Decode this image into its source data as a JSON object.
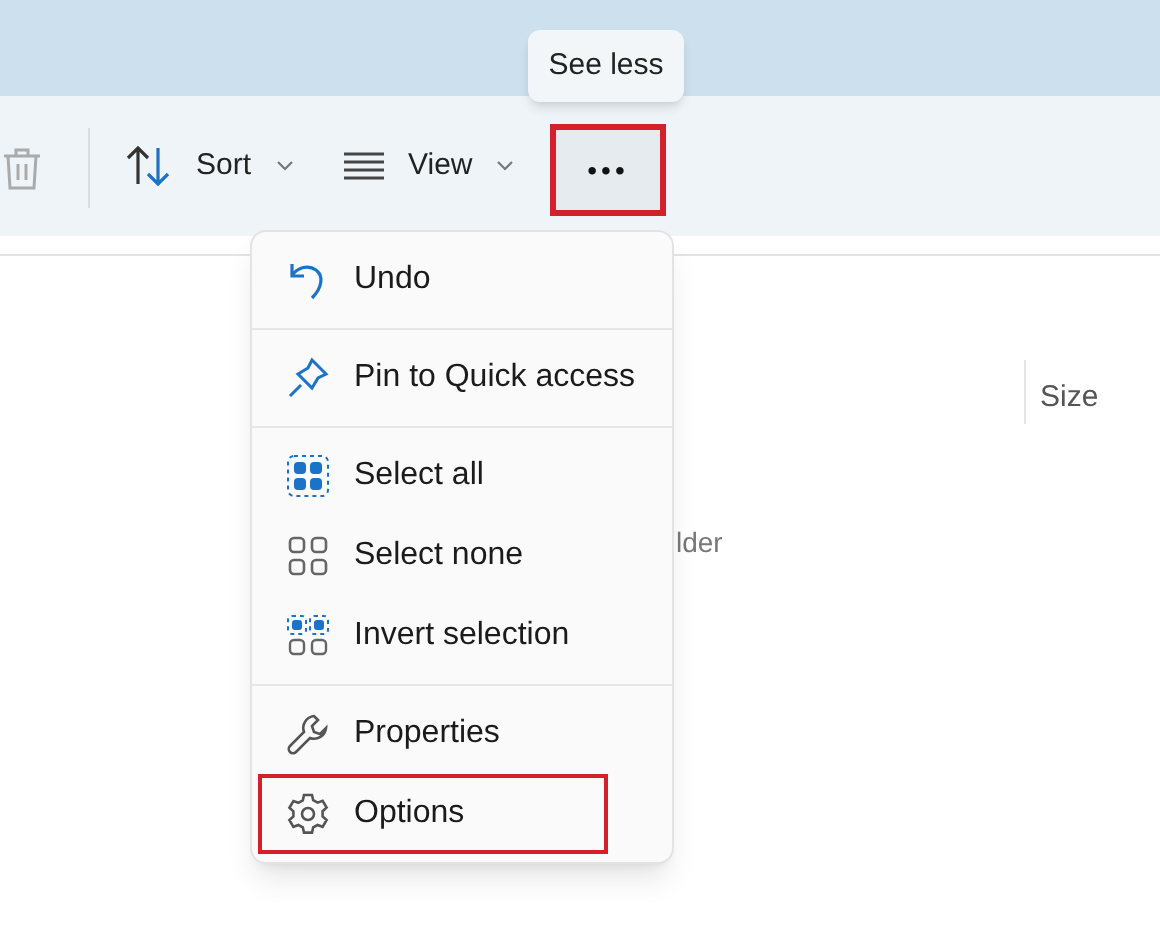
{
  "tooltip": {
    "text": "See less"
  },
  "toolbar": {
    "buttons": [
      {
        "kind": "delete"
      },
      {
        "kind": "sort",
        "label": "Sort",
        "dropdown": true
      },
      {
        "kind": "view",
        "label": "View",
        "dropdown": true
      },
      {
        "kind": "more",
        "label": "•••",
        "highlighted": true
      }
    ]
  },
  "file_list": {
    "column_3": "Size",
    "empty_text": "lder"
  },
  "menu": {
    "groups": [
      [
        {
          "kind": "undo",
          "label": "Undo",
          "highlighted": false
        }
      ],
      [
        {
          "kind": "pin",
          "label": "Pin to Quick access",
          "highlighted": false
        }
      ],
      [
        {
          "kind": "select-all",
          "label": "Select all",
          "highlighted": false
        },
        {
          "kind": "select-none",
          "label": "Select none",
          "highlighted": false
        },
        {
          "kind": "invert",
          "label": "Invert selection",
          "highlighted": false
        }
      ],
      [
        {
          "kind": "properties",
          "label": "Properties",
          "highlighted": false
        },
        {
          "kind": "options",
          "label": "Options",
          "highlighted": true
        }
      ]
    ]
  }
}
